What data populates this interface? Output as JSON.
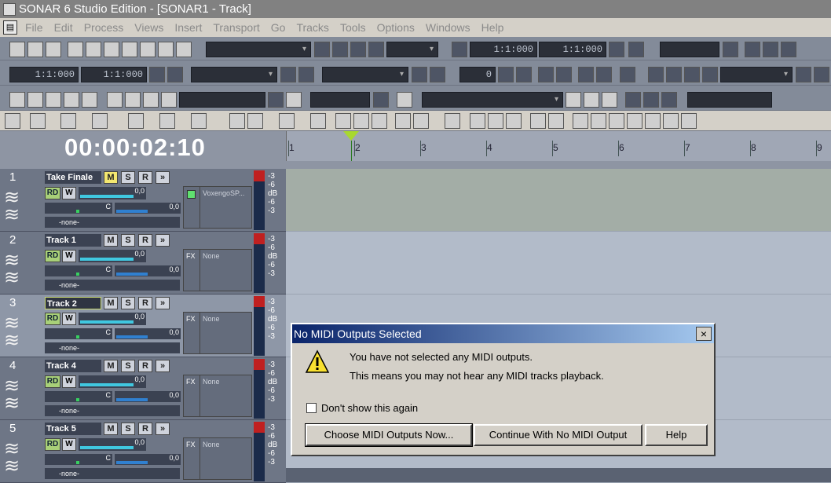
{
  "window": {
    "title": "SONAR 6 Studio Edition - [SONAR1 - Track]"
  },
  "menu": [
    "File",
    "Edit",
    "Process",
    "Views",
    "Insert",
    "Transport",
    "Go",
    "Tracks",
    "Tools",
    "Options",
    "Windows",
    "Help"
  ],
  "toolbar": {
    "lcd_values": [
      "1:1:000",
      "1:1:000",
      "1:1:000",
      "1:1:000",
      "0"
    ],
    "time": "00:00:02:10"
  },
  "ruler": {
    "ticks": [
      "1",
      "2",
      "3",
      "4",
      "5",
      "6",
      "7",
      "8",
      "9"
    ]
  },
  "tracks": [
    {
      "num": "1",
      "name": "Take Finale",
      "vol": "0,0",
      "pan": "C",
      "send": "0,0",
      "route": "-none-",
      "fx": "VoxengoSP...",
      "m_on": true
    },
    {
      "num": "2",
      "name": "Track 1",
      "vol": "0,0",
      "pan": "C",
      "send": "0,0",
      "route": "-none-",
      "fx_label": "FX",
      "fx": "None"
    },
    {
      "num": "3",
      "name": "Track 2",
      "vol": "0,0",
      "pan": "C",
      "send": "0,0",
      "route": "-none-",
      "fx_label": "FX",
      "fx": "None"
    },
    {
      "num": "4",
      "name": "Track 4",
      "vol": "0,0",
      "pan": "C",
      "send": "0,0",
      "route": "-none-",
      "fx_label": "FX",
      "fx": "None"
    },
    {
      "num": "5",
      "name": "Track 5",
      "vol": "0,0",
      "pan": "C",
      "send": "0,0",
      "route": "-none-",
      "fx_label": "FX",
      "fx": "None"
    }
  ],
  "track_buttons": {
    "m": "M",
    "s": "S",
    "r": "R",
    "rd": "RD",
    "w": "W",
    "db": "dB"
  },
  "dialog": {
    "title": "No MIDI Outputs Selected",
    "close": "×",
    "line1": "You have not selected any MIDI outputs.",
    "line2": "This means you may not hear any MIDI tracks playback.",
    "checkbox": "Don't show this again",
    "btn_choose": "Choose MIDI Outputs Now...",
    "btn_continue": "Continue With No MIDI Output",
    "btn_help": "Help"
  }
}
